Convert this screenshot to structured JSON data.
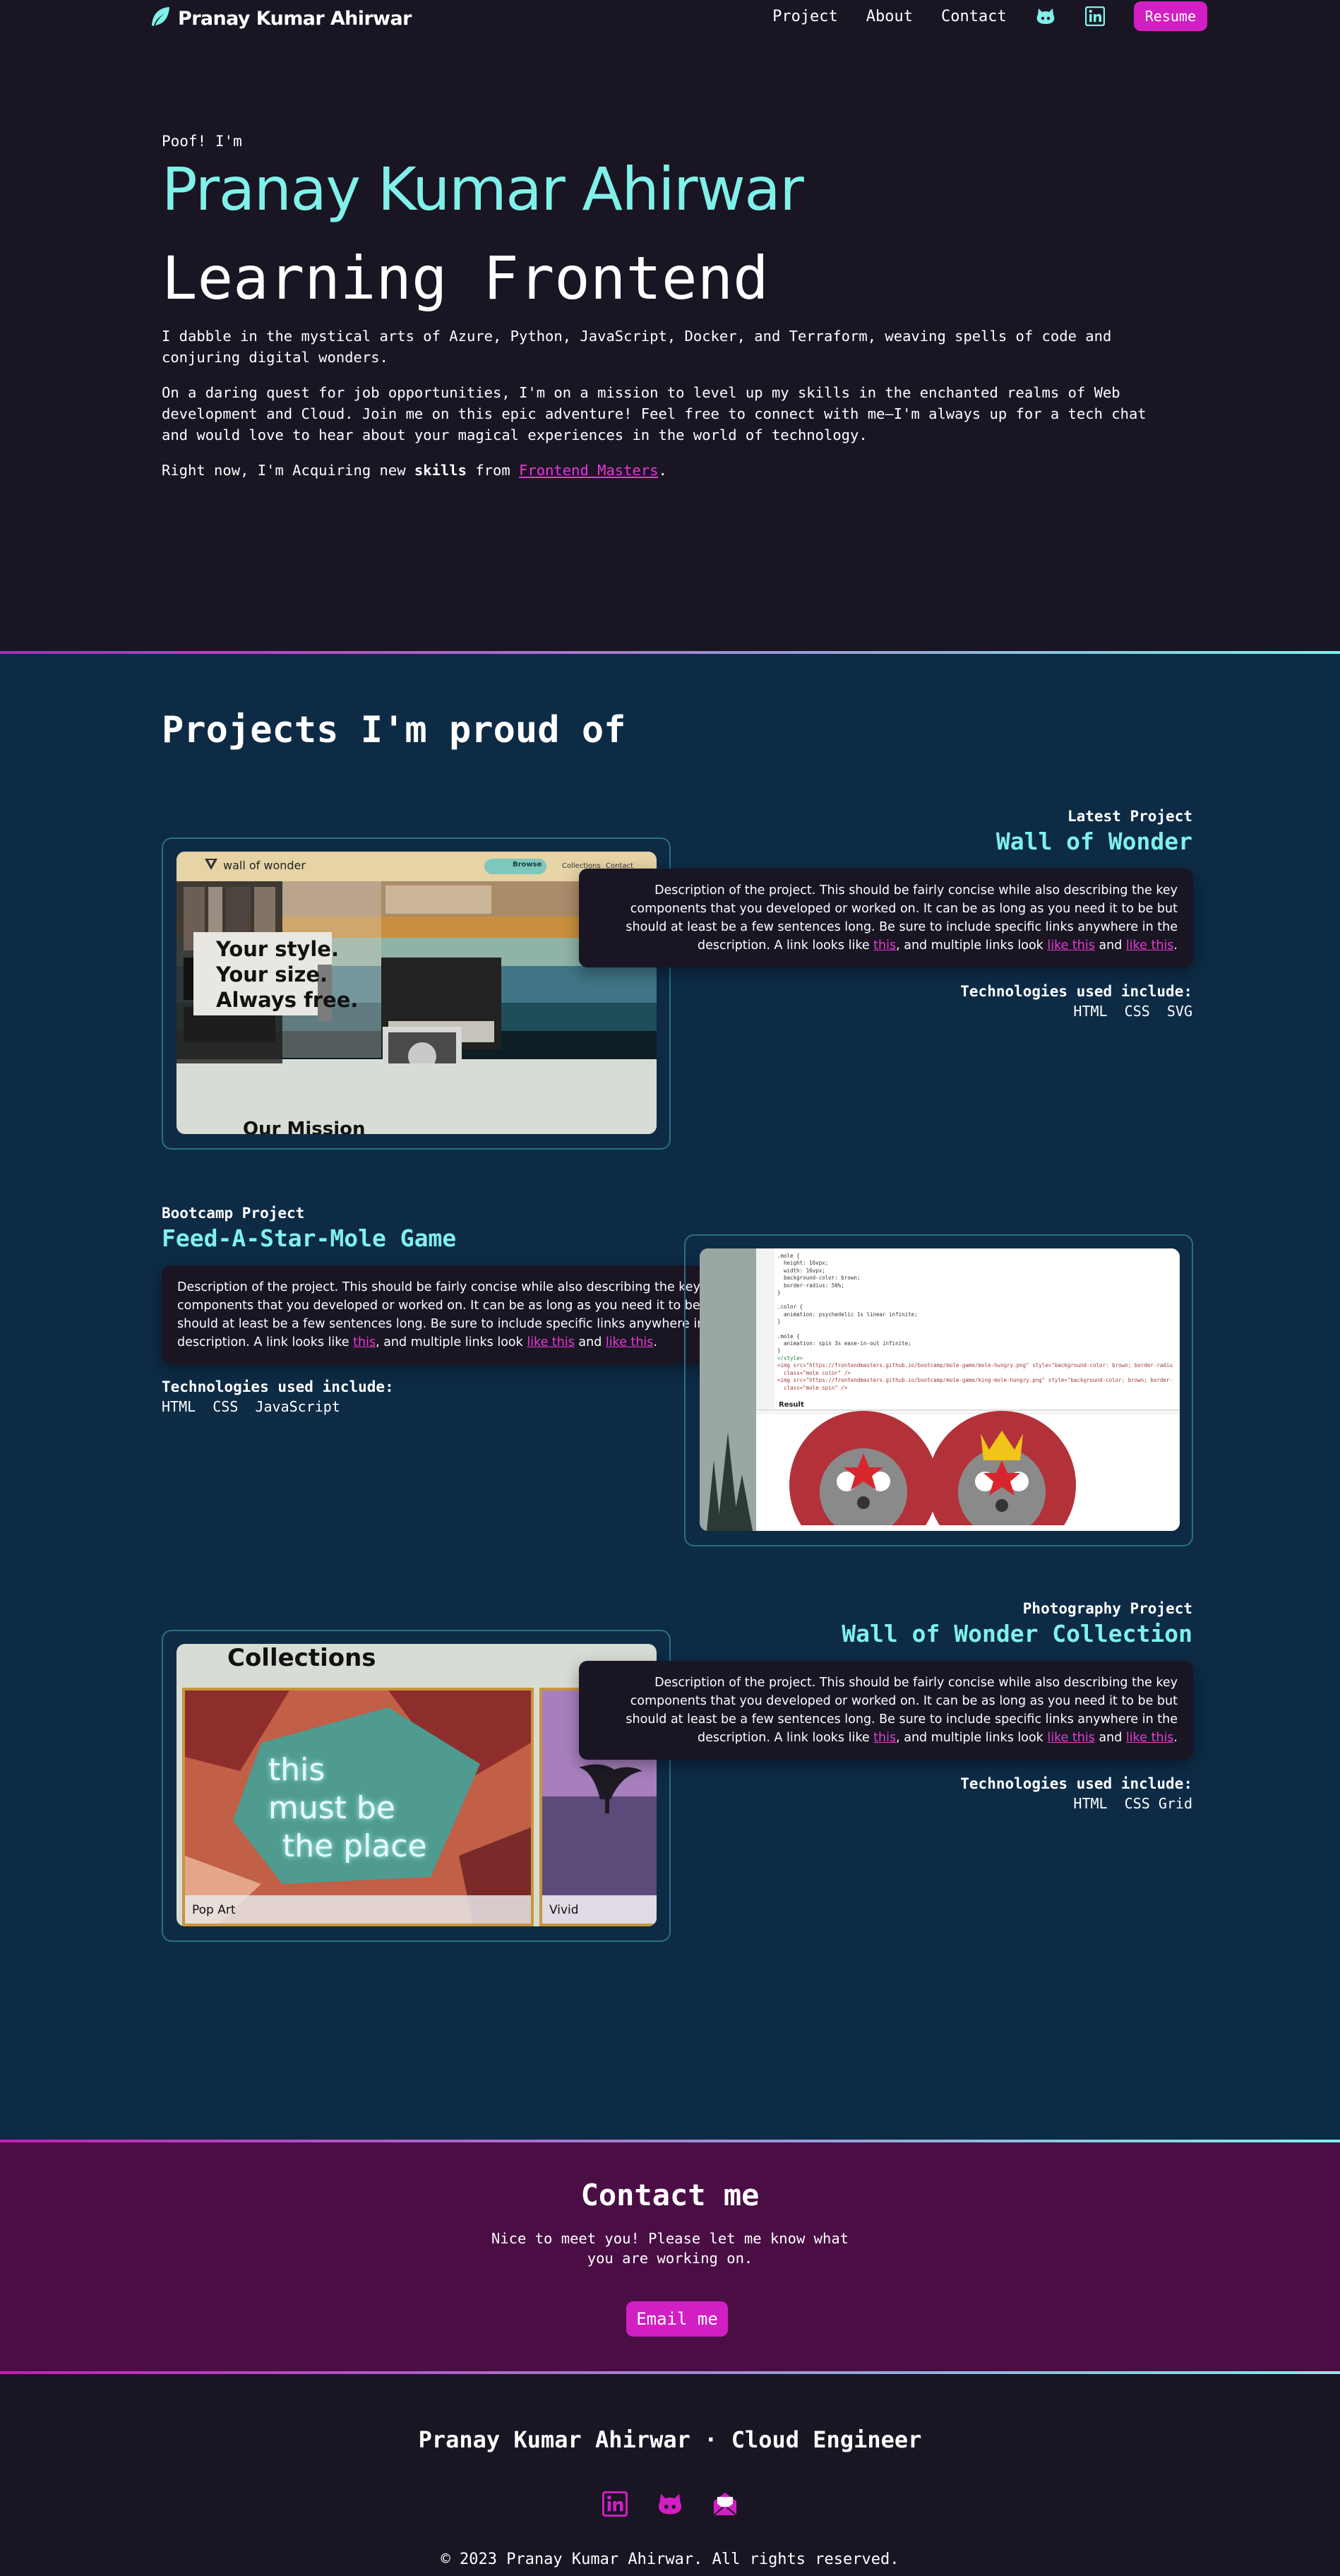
{
  "nav": {
    "brand": "Pranay Kumar Ahirwar",
    "links": [
      "Project",
      "About",
      "Contact"
    ],
    "icons": [
      "github-icon",
      "linkedin-icon"
    ],
    "resume": "Resume"
  },
  "hero": {
    "intro": "Poof! I'm",
    "name": "Pranay Kumar Ahirwar",
    "subtitle": "Learning Frontend",
    "p1": "I dabble in the mystical arts of Azure, Python, JavaScript, Docker, and Terraform, weaving spells of code and conjuring digital wonders.",
    "p2": "On a daring quest for job opportunities, I'm on a mission to level up my skills in the enchanted realms of Web development and Cloud. Join me on this epic adventure! Feel free to connect with me—I'm always up for a tech chat and would love to hear about your magical experiences in the world of technology.",
    "p3_prefix": "Right now, I'm Acquiring new ",
    "p3_bold": "skills",
    "p3_mid": " from ",
    "p3_link": "Frontend Masters",
    "p3_suffix": "."
  },
  "projects": {
    "title": "Projects I'm proud of",
    "desc_prefix": "Description of the project. This should be fairly concise while also describing the key components that you developed or worked on. It can be as long as you need it to be but should at least be a few sentences long. Be sure to include specific links anywhere in the description. A link looks like ",
    "desc_link1": "this",
    "desc_mid": ", and multiple links look ",
    "desc_link2": "like this",
    "desc_and": " and ",
    "desc_link3": "like this",
    "desc_end": ".",
    "tech_title": "Technologies used include:",
    "items": [
      {
        "kicker": "Latest Project",
        "title": "Wall of Wonder",
        "tech": "HTML  CSS  SVG"
      },
      {
        "kicker": "Bootcamp Project",
        "title": "Feed-A-Star-Mole Game",
        "tech": "HTML  CSS  JavaScript"
      },
      {
        "kicker": "Photography Project",
        "title": "Wall of Wonder Collection",
        "tech": "HTML  CSS Grid"
      }
    ],
    "shot1": {
      "logo": "wall of wonder",
      "button": "Browse",
      "nav1": "Collections",
      "nav2": "Contact",
      "headline1": "Your style.",
      "headline2": "Your size.",
      "headline3": "Always free.",
      "mission": "Our Mission"
    },
    "shot2": {
      "code": [
        ".mole {",
        "  height: 16vpx;",
        "  width: 16vpx;",
        "  background-color: brown;",
        "  border-radius: 50%;",
        "}",
        "",
        ".color {",
        "  animation: psychedelic 1s linear infinite;",
        "}",
        "",
        ".mole {",
        "  animation: spin 3s ease-in-out infinite;",
        "}",
        "</style>",
        "<img src=\"https://frontendmasters.github.io/bootcamp/mole-game/mole-hungry.png\" style=\"background-color: brown; border-radius: 50%\"",
        "  class=\"mole color\" />",
        "<img src=\"https://frontendmasters.github.io/bootcamp/mole-game/king-mole-hungry.png\" style=\"background-color: brown; border-radius: 50%\"",
        "  class=\"mole spin\" />"
      ],
      "result_label": "Result"
    },
    "shot3": {
      "heading": "Collections",
      "neon1": "this",
      "neon2": "must be",
      "neon3": "the place",
      "label1": "Pop Art",
      "label2": "Vivid"
    }
  },
  "contact": {
    "title": "Contact me",
    "text": "Nice to meet you! Please let me know what you are working on.",
    "button": "Email me"
  },
  "footer": {
    "title": "Pranay Kumar Ahirwar · Cloud Engineer",
    "icons": [
      "linkedin-icon",
      "github-icon",
      "mail-icon"
    ],
    "copyright": "© 2023 Pranay Kumar Ahirwar. All rights reserved."
  },
  "colors": {
    "accent_pink": "#d21fc3",
    "accent_cyan": "#7ff1ea",
    "dark_bg": "#1a1523",
    "projects_bg": "#0d2b45",
    "contact_bg": "#4a0e45"
  }
}
